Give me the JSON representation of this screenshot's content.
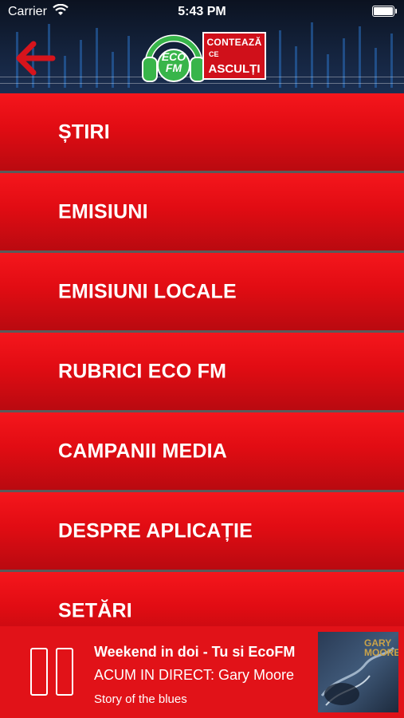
{
  "status_bar": {
    "carrier": "Carrier",
    "time": "5:43 PM"
  },
  "header": {
    "back_icon": "arrow-left-icon",
    "logo": {
      "line1": "CONTEAZĂ",
      "line2": "CE",
      "line3": "ASCULȚI",
      "eco": "ECO FM",
      "colors": {
        "green": "#38b54a",
        "red": "#d0101a"
      }
    }
  },
  "menu": {
    "items": [
      {
        "label": "ȘTIRI"
      },
      {
        "label": "EMISIUNI"
      },
      {
        "label": "EMISIUNI LOCALE"
      },
      {
        "label": "RUBRICI ECO FM"
      },
      {
        "label": "CAMPANII MEDIA"
      },
      {
        "label": "DESPRE APLICAȚIE"
      },
      {
        "label": "SETĂRI"
      }
    ]
  },
  "player": {
    "title": "Weekend in doi - Tu si EcoFM",
    "live": "ACUM IN DIRECT: Gary Moore",
    "song": "Story of the blues",
    "cover_text": "GARY MOORE",
    "state_icon": "pause-icon"
  },
  "colors": {
    "accent": "#e11218",
    "header_bg": "#14233d"
  }
}
